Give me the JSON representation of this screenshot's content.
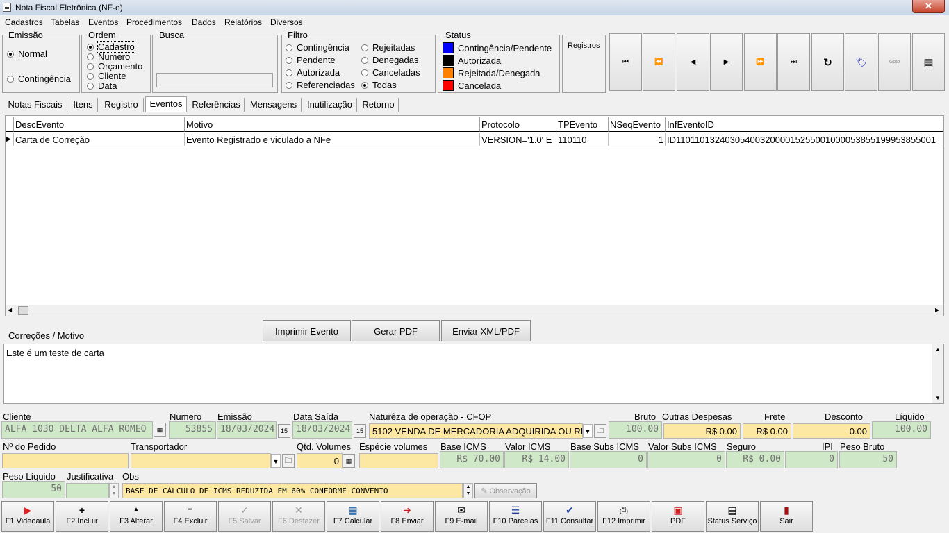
{
  "window": {
    "title": "Nota Fiscal Eletrônica (NF-e)",
    "close": "✕"
  },
  "menu": [
    "Cadastros",
    "Tabelas",
    "Eventos",
    "Procedimentos",
    "Dados",
    "Relatórios",
    "Diversos"
  ],
  "emissao": {
    "title": "Emissão",
    "options": [
      "Normal",
      "Contingência"
    ],
    "selected": "Normal"
  },
  "ordem": {
    "title": "Ordem",
    "options": [
      "Cadastro",
      "Numero",
      "Orçamento",
      "Cliente",
      "Data"
    ],
    "selected": "Cadastro"
  },
  "busca": {
    "title": "Busca",
    "value": ""
  },
  "filtro": {
    "title": "Filtro",
    "col1": [
      "Contingência",
      "Pendente",
      "Autorizada",
      "Referenciadas"
    ],
    "col2": [
      "Rejeitadas",
      "Denegadas",
      "Canceladas",
      "Todas"
    ],
    "selected": "Todas"
  },
  "status": {
    "title": "Status",
    "items": [
      {
        "label": "Contingência/Pendente",
        "color": "#0000ff"
      },
      {
        "label": "Autorizada",
        "color": "#000000"
      },
      {
        "label": "Rejeitada/Denegada",
        "color": "#ff8000"
      },
      {
        "label": "Cancelada",
        "color": "#ff0000"
      }
    ]
  },
  "registros": {
    "label": "Registros"
  },
  "nav": [
    {
      "name": "first-record-icon",
      "glyph": "⏮"
    },
    {
      "name": "prev-page-icon",
      "glyph": "⏪"
    },
    {
      "name": "prev-record-icon",
      "glyph": "◀"
    },
    {
      "name": "next-record-icon",
      "glyph": "▶"
    },
    {
      "name": "next-page-icon",
      "glyph": "⏩"
    },
    {
      "name": "last-record-icon",
      "glyph": "⏭"
    },
    {
      "name": "refresh-icon",
      "glyph": "↻"
    },
    {
      "name": "tag-icon",
      "glyph": "🏷"
    },
    {
      "name": "goto-icon",
      "glyph": "Goto"
    },
    {
      "name": "form-icon",
      "glyph": "▤"
    }
  ],
  "tabs": [
    "Notas Fiscais",
    "Itens",
    "Registro",
    "Eventos",
    "Referências",
    "Mensagens",
    "Inutilização",
    "Retorno"
  ],
  "active_tab": "Eventos",
  "grid": {
    "headers": [
      "DescEvento",
      "Motivo",
      "Protocolo",
      "TPEvento",
      "NSeqEvento",
      "InfEventoID"
    ],
    "rows": [
      [
        "Carta de Correção",
        "Evento Registrado e viculado a NFe",
        "VERSION='1.0' E",
        "110110",
        "1",
        "ID110110132403054003200001525500100005385519995385500​1"
      ]
    ]
  },
  "correcoes": {
    "label": "Correções / Motivo",
    "text": "Este é um teste de carta"
  },
  "actions": {
    "imprimir": "Imprimir Evento",
    "pdf": "Gerar PDF",
    "enviar": "Enviar XML/PDF"
  },
  "form": {
    "cliente": {
      "label": "Cliente",
      "value": "ALFA 1030 DELTA ALFA ROMEO"
    },
    "numero": {
      "label": "Numero",
      "value": "53855"
    },
    "emissao": {
      "label": "Emissão",
      "value": "18/03/2024"
    },
    "data_saida": {
      "label": "Data Saída",
      "value": "18/03/2024"
    },
    "cfop": {
      "label": "Naturêza de operação - CFOP",
      "value": "5102 VENDA DE MERCADORIA ADQUIRIDA OU RE"
    },
    "bruto": {
      "label": "Bruto",
      "value": "100.00"
    },
    "outras": {
      "label": "Outras Despesas",
      "value": "R$ 0.00"
    },
    "frete": {
      "label": "Frete",
      "value": "R$ 0.00"
    },
    "desconto": {
      "label": "Desconto",
      "value": "0.00"
    },
    "liquido": {
      "label": "Líquido",
      "value": "100.00"
    },
    "pedido": {
      "label": "Nº do Pedido",
      "value": ""
    },
    "transportador": {
      "label": "Transportador",
      "value": ""
    },
    "qtd_volumes": {
      "label": "Qtd. Volumes",
      "value": "0"
    },
    "especie": {
      "label": "Espécie volumes",
      "value": ""
    },
    "base_icms": {
      "label": "Base ICMS",
      "value": "R$ 70.00"
    },
    "valor_icms": {
      "label": "Valor ICMS",
      "value": "R$ 14.00"
    },
    "base_subs": {
      "label": "Base Subs ICMS",
      "value": "0"
    },
    "valor_subs": {
      "label": "Valor Subs ICMS",
      "value": "0"
    },
    "seguro": {
      "label": "Seguro",
      "value": "R$ 0.00"
    },
    "ipi": {
      "label": "IPI",
      "value": "0"
    },
    "peso_bruto": {
      "label": "Peso Bruto",
      "value": "50"
    },
    "peso_liquido": {
      "label": "Peso Líquido",
      "value": "50"
    },
    "justificativa": {
      "label": "Justificativa",
      "value": ""
    },
    "obs": {
      "label": "Obs",
      "value": "BASE DE CÁLCULO DE ICMS REDUZIDA EM  60%  CONFORME  CONVENIO"
    },
    "observacao_btn": "Observação"
  },
  "fkeys": [
    {
      "label": "F1 Videoaula",
      "icon": "▶",
      "color": "#e02020",
      "enabled": true
    },
    {
      "label": "F2 Incluir",
      "icon": "+",
      "color": "#000",
      "enabled": true
    },
    {
      "label": "F3 Alterar",
      "icon": "▲",
      "color": "#000",
      "enabled": true
    },
    {
      "label": "F4 Excluir",
      "icon": "━",
      "color": "#000",
      "enabled": true
    },
    {
      "label": "F5 Salvar",
      "icon": "✓",
      "color": "#aaa",
      "enabled": false
    },
    {
      "label": "F6 Desfazer",
      "icon": "✕",
      "color": "#aaa",
      "enabled": false
    },
    {
      "label": "F7 Calcular",
      "icon": "▦",
      "color": "#2060a0",
      "enabled": true
    },
    {
      "label": "F8 Enviar",
      "icon": "➜",
      "color": "#c02020",
      "enabled": true
    },
    {
      "label": "F9 E-mail",
      "icon": "✉",
      "color": "#333",
      "enabled": true
    },
    {
      "label": "F10 Parcelas",
      "icon": "☰",
      "color": "#2040a0",
      "enabled": true
    },
    {
      "label": "F11 Consultar",
      "icon": "✔",
      "color": "#2040a0",
      "enabled": true
    },
    {
      "label": "F12 Imprimir",
      "icon": "⎙",
      "color": "#555",
      "enabled": true
    },
    {
      "label": "PDF",
      "icon": "▣",
      "color": "#d02020",
      "enabled": true
    },
    {
      "label": "Status Serviço",
      "icon": "▤",
      "color": "#333",
      "enabled": true
    },
    {
      "label": "Sair",
      "icon": "▮",
      "color": "#a01010",
      "enabled": true
    }
  ]
}
